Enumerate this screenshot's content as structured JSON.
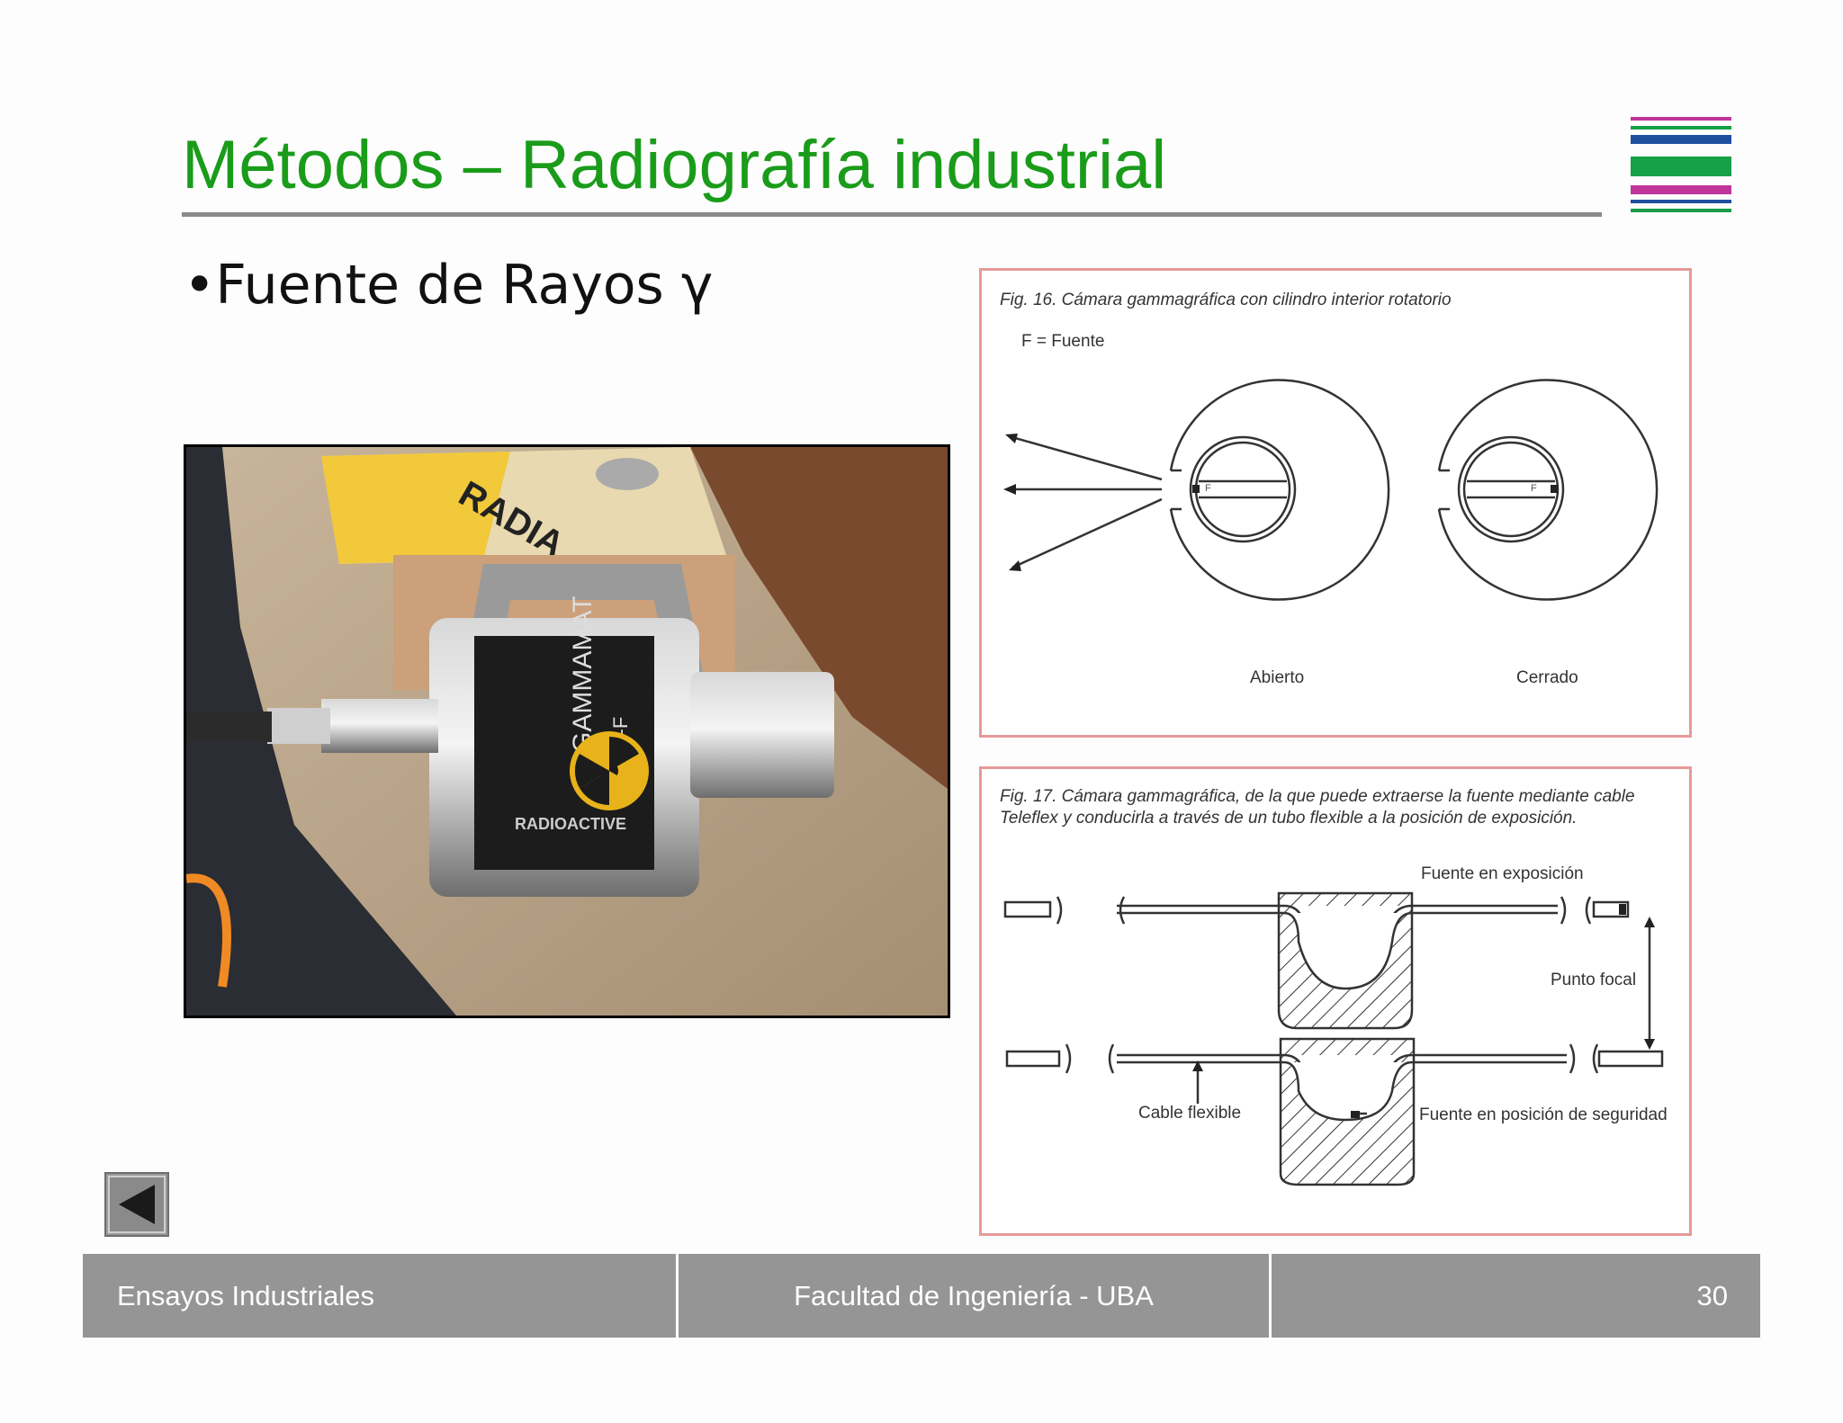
{
  "slide": {
    "title": "Métodos – Radiografía industrial",
    "bullet": "•Fuente de Rayos γ"
  },
  "photo": {
    "label_gamma": "GAMMAMAT",
    "label_model": "TI-F",
    "label_radioactive": "RADIOACTIVE",
    "label_sign": "RADIA"
  },
  "fig16": {
    "caption": "Fig. 16. Cámara gammagráfica con cilindro interior rotatorio",
    "legend": "F = Fuente",
    "source_mark": "F",
    "label_open": "Abierto",
    "label_closed": "Cerrado"
  },
  "fig17": {
    "caption_line1": "Fig. 17. Cámara gammagráfica, de la que puede extraerse la fuente mediante cable",
    "caption_line2": "Teleflex y conducirla a través de un tubo flexible a la posición de exposición.",
    "label_exposure": "Fuente en exposición",
    "label_focal": "Punto focal",
    "label_cable": "Cable flexible",
    "label_safe": "Fuente en posición de seguridad"
  },
  "footer": {
    "left": "Ensayos Industriales",
    "center": "Facultad de Ingeniería - UBA",
    "page": "30"
  },
  "colors": {
    "title": "#1a9c1a",
    "footer_bg": "#959595",
    "figure_border": "#e49a9a",
    "logo_magenta": "#c0359a",
    "logo_blue": "#1f4f9f",
    "logo_green": "#18a048"
  },
  "icons": {
    "back": "triangle-left-icon"
  }
}
